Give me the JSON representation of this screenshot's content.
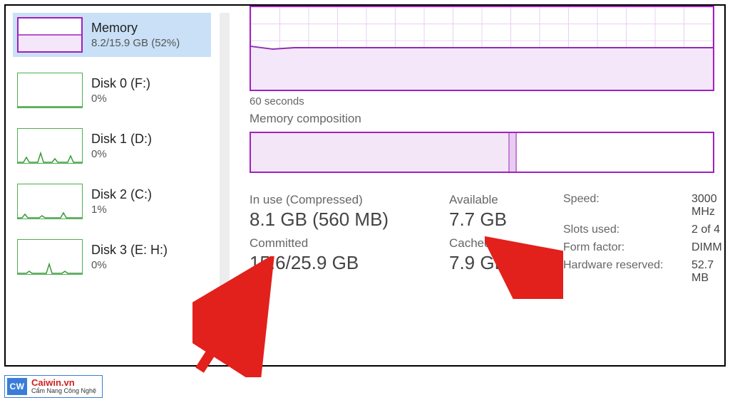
{
  "sidebar": {
    "items": [
      {
        "title": "Memory",
        "sub": "8.2/15.9 GB (52%)"
      },
      {
        "title": "Disk 0 (F:)",
        "sub": "0%"
      },
      {
        "title": "Disk 1 (D:)",
        "sub": "0%"
      },
      {
        "title": "Disk 2 (C:)",
        "sub": "1%"
      },
      {
        "title": "Disk 3 (E: H:)",
        "sub": "0%"
      }
    ]
  },
  "graph": {
    "axis_label": "60 seconds",
    "composition_label": "Memory composition",
    "composition_used_pct": 56
  },
  "stats": {
    "inuse_label": "In use (Compressed)",
    "inuse_value": "8.1 GB (560 MB)",
    "available_label": "Available",
    "available_value": "7.7 GB",
    "committed_label": "Committed",
    "committed_value": "15.6/25.9 GB",
    "cached_label": "Cached",
    "cached_value": "7.9 GB"
  },
  "specs": {
    "speed_k": "Speed:",
    "speed_v": "3000 MHz",
    "slots_k": "Slots used:",
    "slots_v": "2 of 4",
    "form_k": "Form factor:",
    "form_v": "DIMM",
    "hw_k": "Hardware reserved:",
    "hw_v": "52.7 MB"
  },
  "watermark": {
    "logo": "CW",
    "title": "Caiwin.vn",
    "sub": "Cẩm Nang Công Nghệ"
  }
}
